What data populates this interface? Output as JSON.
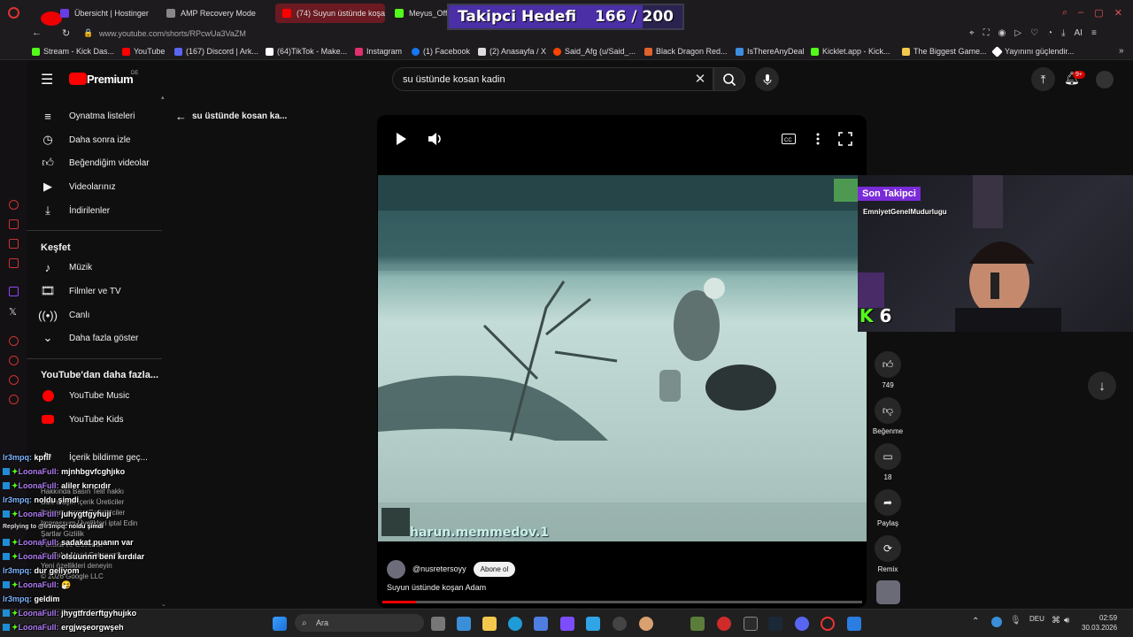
{
  "browser": {
    "tabs": [
      {
        "label": "Übersicht | Hostinger",
        "color": "#673de6"
      },
      {
        "label": "AMP Recovery Mode",
        "color": "#888888"
      },
      {
        "label": "(74) Suyun üstünde koşan",
        "color": "#ff0000"
      },
      {
        "label": "Meyus_Offi",
        "color": "#53fc18"
      }
    ],
    "url": "www.youtube.com/shorts/RPcwUa3VaZM",
    "bookmarks": [
      {
        "label": "Stream - Kick Das...",
        "color": "#53fc18"
      },
      {
        "label": "YouTube",
        "color": "#ff0000"
      },
      {
        "label": "(167) Discord | Ark...",
        "color": "#5865f2"
      },
      {
        "label": "(64)TikTok - Make...",
        "color": "#ffffff"
      },
      {
        "label": "Instagram",
        "color": "#e1306c"
      },
      {
        "label": "(1) Facebook",
        "color": "#1877f2"
      },
      {
        "label": "(2) Anasayfa / X",
        "color": "#dddddd"
      },
      {
        "label": "Said_Afg (u/Said_...",
        "color": "#ff4500"
      },
      {
        "label": "Black Dragon Red...",
        "color": "#e0632b"
      },
      {
        "label": "IsThereAnyDeal",
        "color": "#3e8ede"
      },
      {
        "label": "Kicklet.app - Kick...",
        "color": "#53fc18"
      },
      {
        "label": "The Biggest Game...",
        "color": "#f2c94c"
      },
      {
        "label": "Yayınını güçlendir...",
        "color": "#ffffff"
      }
    ]
  },
  "overlay": {
    "goal_label": "Takipci Hedefi",
    "goal_count": "166 / 200",
    "goal_fraction": 0.83,
    "last_follower_label": "Son Takipci",
    "last_follower_name": "EmniyetGenelMudurlugu",
    "kick_count": "6"
  },
  "youtube": {
    "logo_text": "Premium",
    "logo_region": "DE",
    "search_value": "su üstünde kosan kadin",
    "back_label": "su üstünde kosan ka...",
    "sidebar": {
      "items_top": [
        {
          "label": "Oynatma listeleri",
          "icon": "playlist-icon"
        },
        {
          "label": "Daha sonra izle",
          "icon": "clock-icon"
        },
        {
          "label": "Beğendiğim videolar",
          "icon": "thumb-up-icon"
        },
        {
          "label": "Videolarınız",
          "icon": "video-icon"
        },
        {
          "label": "İndirilenler",
          "icon": "download-icon"
        }
      ],
      "explore_title": "Keşfet",
      "explore_items": [
        {
          "label": "Müzik",
          "icon": "music-icon"
        },
        {
          "label": "Filmler ve TV",
          "icon": "film-icon"
        },
        {
          "label": "Canlı",
          "icon": "live-icon"
        },
        {
          "label": "Daha fazla göster",
          "icon": "chevron-down-icon"
        }
      ],
      "more_title": "YouTube'dan daha fazla...",
      "more_items": [
        {
          "label": "YouTube Music",
          "icon": "youtube-music-icon"
        },
        {
          "label": "YouTube Kids",
          "icon": "youtube-kids-icon"
        }
      ],
      "extra_item": "İçerik bildirme geç...",
      "footer": [
        "Hakkında  Basın  Telif hakkı",
        "Bize ulaşın  İçerik Üreticiler",
        "Reklam verme  Geliştiriciler",
        "Impressum  Üyelikleri iptal Edin",
        "Şartlar  Gizlilik",
        "Politika ve Güvenlik",
        "YouTube Nasıl Çalışıyor?",
        "Yeni özellikleri deneyin",
        "© 2026 Google LLC"
      ]
    },
    "short": {
      "watermark": "harun.memmedov.1",
      "channel": "@nusretersoyy",
      "subscribe_label": "Abone ol",
      "title": "Suyun üstünde koşan Adam",
      "progress": 0.07
    },
    "actions": [
      {
        "label": "749",
        "icon": "like-icon"
      },
      {
        "label": "Beğenme",
        "icon": "dislike-icon"
      },
      {
        "label": "18",
        "icon": "comment-icon"
      },
      {
        "label": "Paylaş",
        "icon": "share-icon"
      },
      {
        "label": "Remix",
        "icon": "remix-icon"
      }
    ],
    "notif_count": "9+"
  },
  "chat": [
    {
      "user": "lr3mpq:",
      "msg": "kpfii",
      "color": "blue"
    },
    {
      "user": "LoonaFull:",
      "msg": "mjnhbgvfcghjıko",
      "color": "purple"
    },
    {
      "user": "LoonaFull:",
      "msg": "aliler kırıcıdır",
      "color": "purple"
    },
    {
      "user": "lr3mpq:",
      "msg": "noldu şimdi",
      "color": "blue"
    },
    {
      "user": "LoonaFull:",
      "msg": "juhygtfgyhuji",
      "color": "purple"
    },
    {
      "user": "Replying to @lr3mpq:",
      "msg": "noldu şimdi",
      "color": "reply"
    },
    {
      "user": "LoonaFull:",
      "msg": "sadakat puanın var",
      "color": "purple"
    },
    {
      "user": "LoonaFull:",
      "msg": "olsuunnn beni kırdılar",
      "color": "purple"
    },
    {
      "user": "lr3mpq:",
      "msg": "dur geliyom",
      "color": "blue"
    },
    {
      "user": "LoonaFull:",
      "msg": "🤧",
      "color": "purple"
    },
    {
      "user": "lr3mpq:",
      "msg": "geldim",
      "color": "blue"
    },
    {
      "user": "LoonaFull:",
      "msg": "jhygtfrderftgyhujıko",
      "color": "purple"
    },
    {
      "user": "LoonaFull:",
      "msg": "ergjwşeorgwşeh",
      "color": "purple"
    }
  ],
  "taskbar": {
    "search_label": "Ara",
    "language": "DEU",
    "time": "02:59",
    "date": "30.03.2026"
  }
}
